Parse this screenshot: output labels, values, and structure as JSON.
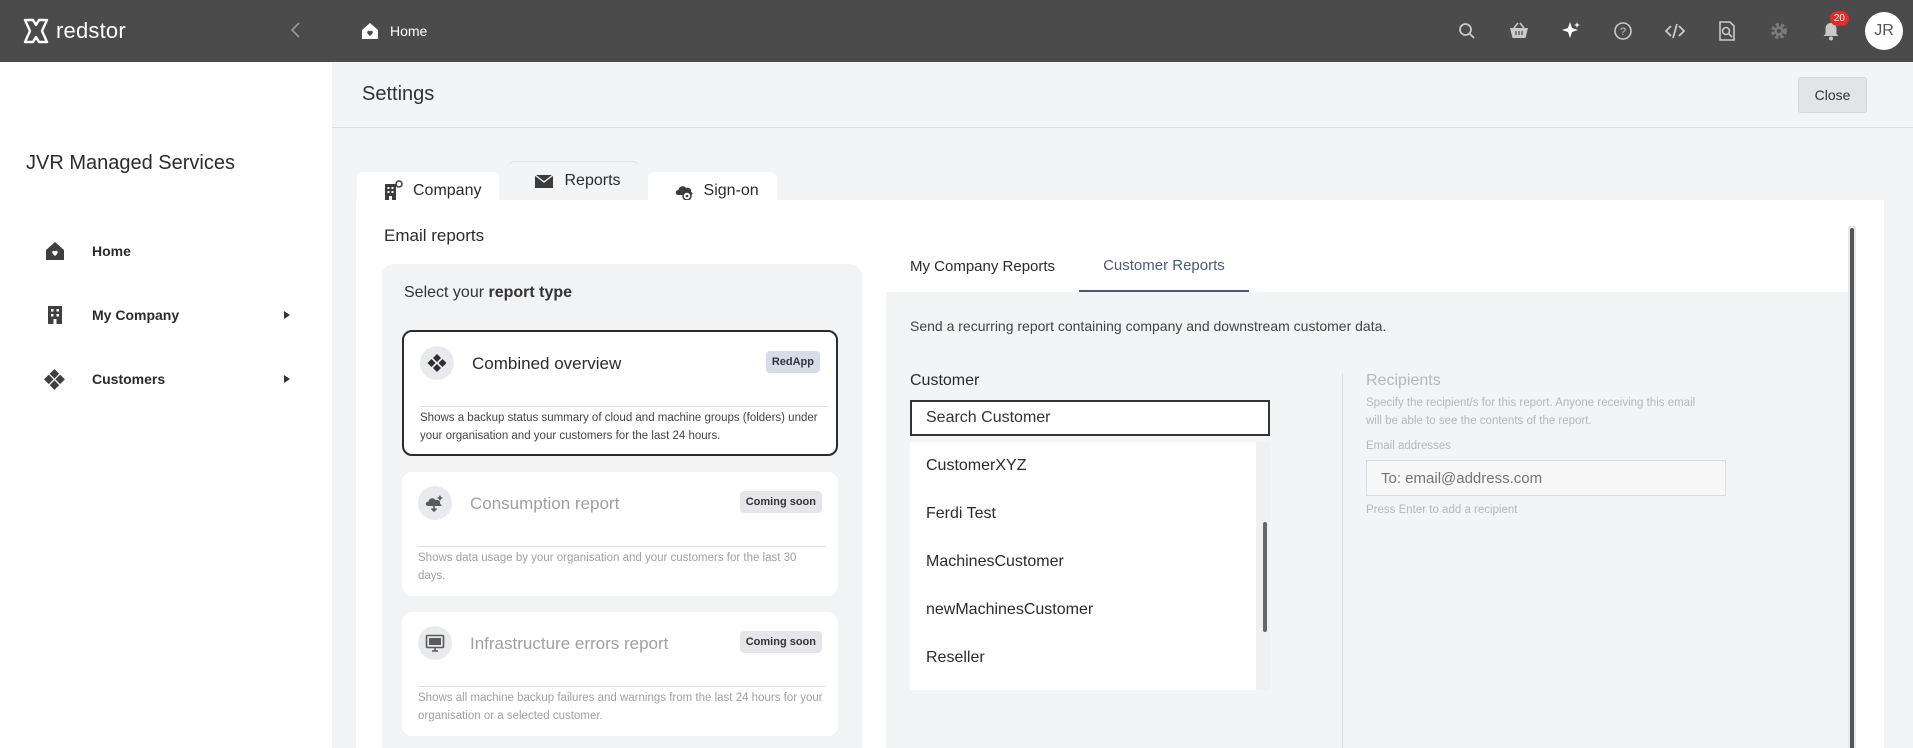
{
  "app": {
    "brand": "redstor",
    "breadcrumb": "Home",
    "notification_count": "20",
    "avatar_initials": "JR"
  },
  "topbar_icons": [
    "search-icon",
    "basket-icon",
    "sparkle-icon",
    "help-icon",
    "code-icon",
    "search-document-icon",
    "gear-icon",
    "bell-icon"
  ],
  "sidebar": {
    "org_name": "JVR Managed Services",
    "items": [
      {
        "label": "Home",
        "icon": "home-icon"
      },
      {
        "label": "My Company",
        "icon": "building-icon"
      },
      {
        "label": "Customers",
        "icon": "customers-icon"
      }
    ]
  },
  "settings": {
    "title": "Settings",
    "close_label": "Close",
    "tabs": [
      {
        "label": "Company"
      },
      {
        "label": "Reports"
      },
      {
        "label": "Sign-on"
      }
    ],
    "active_tab": "Reports"
  },
  "email_reports": {
    "title": "Email reports",
    "select_prefix": "Select your",
    "select_bold": "report type",
    "cards": [
      {
        "title": "Combined overview",
        "badge": "RedApp",
        "desc": "Shows a backup status summary of cloud and machine groups (folders) under your organisation and your customers for the last 24 hours."
      },
      {
        "title": "Consumption report",
        "badge": "Coming soon",
        "desc": "Shows data usage by your organisation and your customers for the last 30 days."
      },
      {
        "title": "Infrastructure errors report",
        "badge": "Coming soon",
        "desc": "Shows all machine backup failures and warnings from the last 24 hours for your organisation or a selected customer."
      }
    ]
  },
  "report_tabs": [
    {
      "label": "My Company Reports"
    },
    {
      "label": "Customer Reports"
    }
  ],
  "customer_reports": {
    "description": "Send a recurring report containing company and downstream customer data.",
    "customer_label": "Customer",
    "customer_search_value": "Search Customer",
    "dropdown_items": [
      "CustomerXYZ",
      "Ferdi Test",
      "MachinesCustomer",
      "newMachinesCustomer",
      "Reseller"
    ],
    "recipients_title": "Recipients",
    "recipients_desc": "Specify the recipient/s for this report. Anyone receiving this email will be able to see the contents of the report.",
    "email_label": "Email addresses",
    "email_placeholder": "To: email@address.com",
    "email_hint": "Press Enter to add a recipient"
  }
}
